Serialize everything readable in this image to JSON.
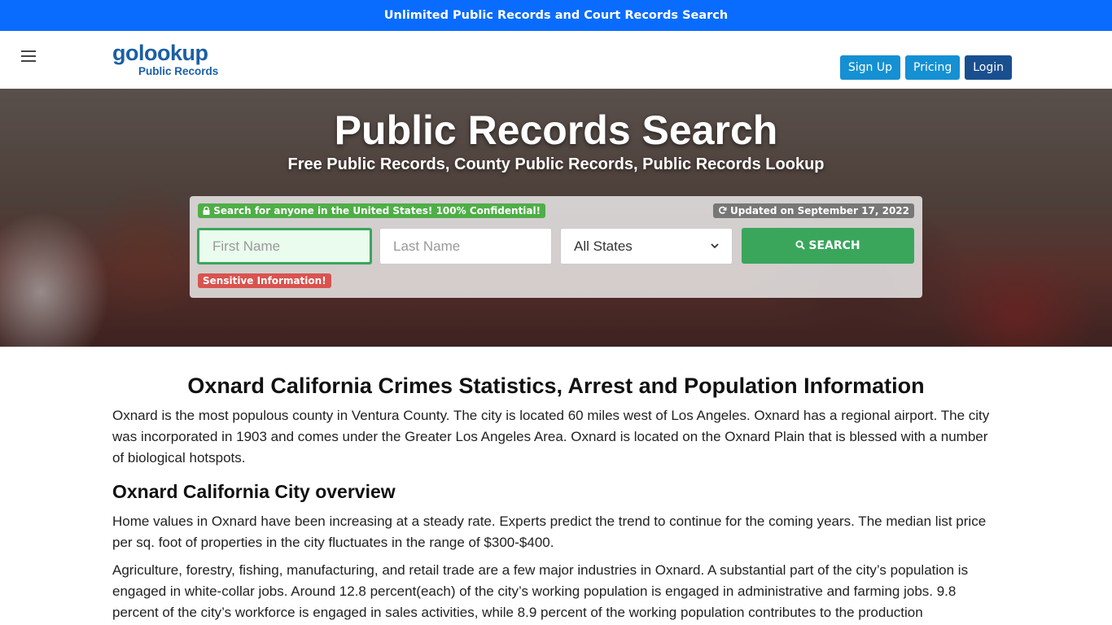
{
  "topbar": {
    "link_text": "Unlimited Public Records and Court Records Search"
  },
  "navbar": {
    "logo_main": "golookup",
    "logo_sub": "Public Records",
    "buttons": {
      "signup": "Sign Up",
      "pricing": "Pricing",
      "login": "Login"
    }
  },
  "hero": {
    "title": "Public Records Search",
    "subtitle": "Free Public Records, County Public Records, Public Records Lookup",
    "search": {
      "confidential_badge": "Search for anyone in the United States! 100% Confidential!",
      "updated_badge": "Updated on September 17, 2022",
      "first_name_placeholder": "First Name",
      "last_name_placeholder": "Last Name",
      "state_selected": "All States",
      "search_button": "SEARCH",
      "sensitive_badge": "Sensitive Information!"
    }
  },
  "article": {
    "title": "Oxnard California Crimes Statistics, Arrest and Population Information",
    "intro": "Oxnard is the most populous county in Ventura County. The city is located 60 miles west of Los Angeles. Oxnard has a regional airport. The city was incorporated in 1903 and comes under the Greater Los Angeles Area. Oxnard is located on the Oxnard Plain that is blessed with a number of biological hotspots.",
    "section_heading": "Oxnard California City overview",
    "paragraphs": [
      "Home values in Oxnard have been increasing at a steady rate. Experts predict the trend to continue for the coming years. The median list price per sq. foot of properties in the city fluctuates in the range of $300-$400.",
      "Agriculture, forestry, fishing, manufacturing, and retail trade are a few major industries in Oxnard. A substantial part of the city’s population is engaged in white-collar jobs. Around 12.8 percent(each) of the city’s working population is engaged in administrative and farming jobs. 9.8 percent of the city’s workforce is engaged in sales activities, while 8.9 percent of the working population contributes to the production"
    ]
  },
  "colors": {
    "topbar": "#0a6cff",
    "brand": "#1b5fa5",
    "search_green": "#3aa65c",
    "sensitive_red": "#d9534f",
    "login_navy": "#1a4f8f"
  },
  "icons": {
    "menu": "hamburger-icon",
    "lock": "lock-icon",
    "refresh": "refresh-icon",
    "search": "search-icon",
    "dropdown": "chevron-down-icon"
  }
}
